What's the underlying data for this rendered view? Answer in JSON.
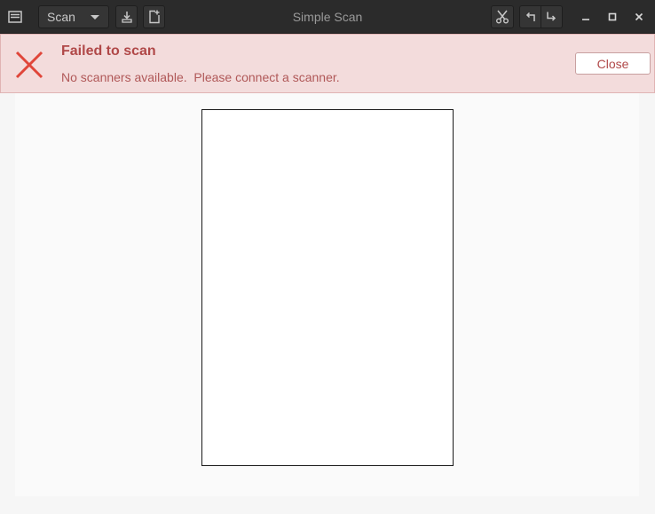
{
  "window": {
    "title": "Simple Scan"
  },
  "toolbar": {
    "menu_icon": "hamburger-menu-icon",
    "scan_label": "Scan",
    "scan_dropdown_icon": "chevron-down-icon",
    "save_icon": "download-icon",
    "new_document_icon": "new-document-icon",
    "crop_icon": "scissors-icon",
    "rotate_left_icon": "rotate-left-icon",
    "rotate_right_icon": "rotate-right-icon"
  },
  "window_controls": {
    "minimize_icon": "minimize-icon",
    "maximize_icon": "maximize-icon",
    "close_icon": "close-icon"
  },
  "infobar": {
    "title": "Failed to scan",
    "message": "No scanners available.  Please connect a scanner.",
    "close_label": "Close",
    "icon": "error-x-icon"
  },
  "colors": {
    "headerbar_bg": "#2b2b2b",
    "infobar_bg": "#f3dcdc",
    "error_red": "#e0463a",
    "error_text": "#b04848"
  }
}
